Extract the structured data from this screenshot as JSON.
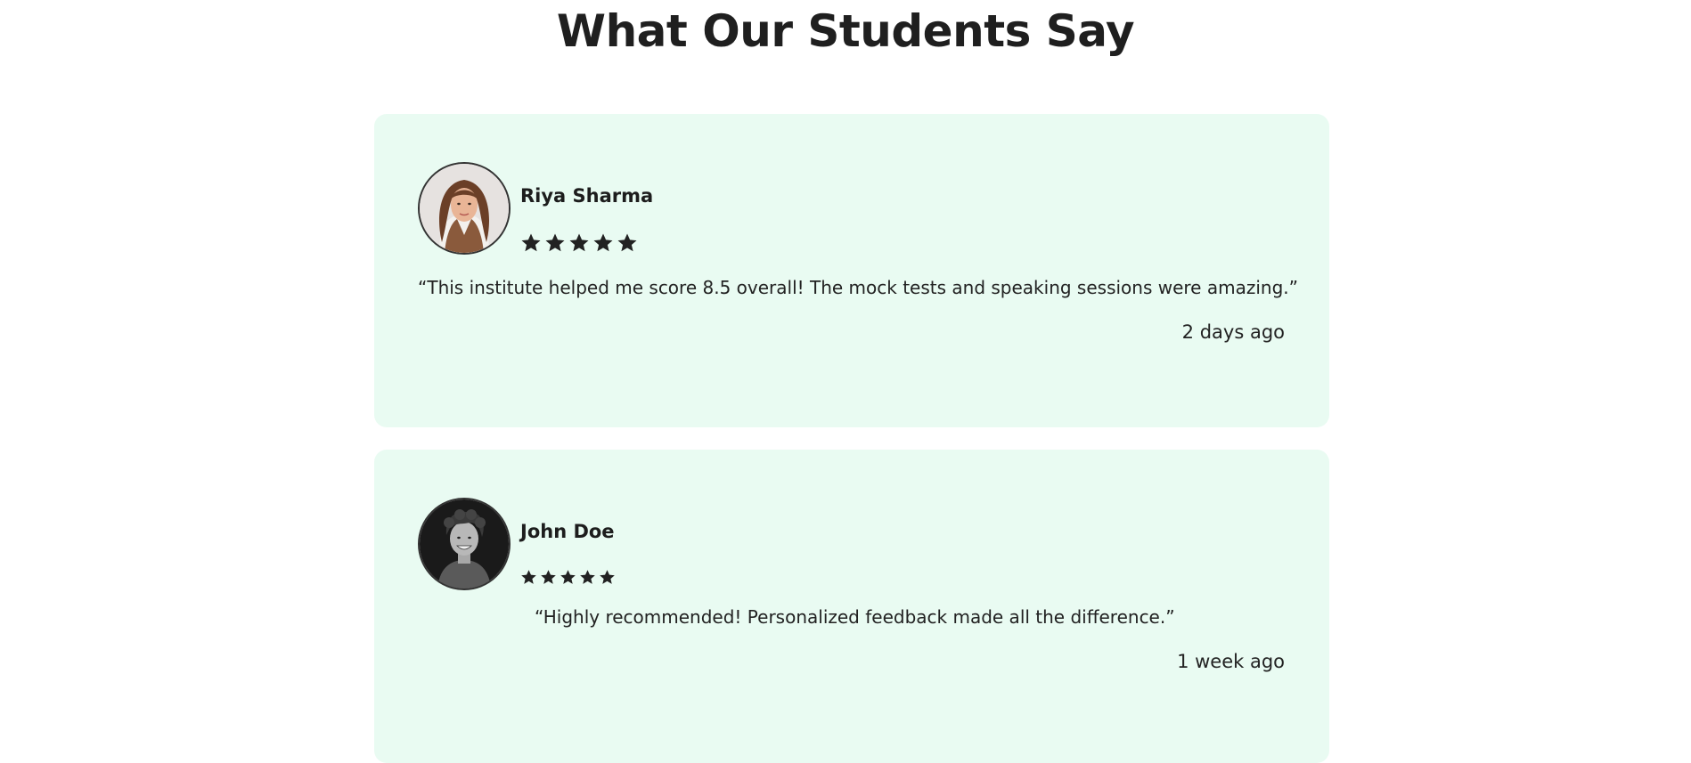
{
  "title": "What Our Students Say",
  "colors": {
    "card_background": "#e9fbf2",
    "text": "#1d1d1d",
    "star": "#222222"
  },
  "testimonials": [
    {
      "name": "Riya Sharma",
      "rating": 5,
      "quote": "“This institute helped me score 8.5 overall! The mock tests and speaking sessions were amazing.”",
      "time": "2 days ago",
      "avatar_icon": "woman-portrait"
    },
    {
      "name": "John Doe",
      "rating": 5,
      "quote": "“Highly recommended! Personalized feedback made all the difference.”",
      "time": "1 week ago",
      "avatar_icon": "man-portrait-bw"
    }
  ]
}
